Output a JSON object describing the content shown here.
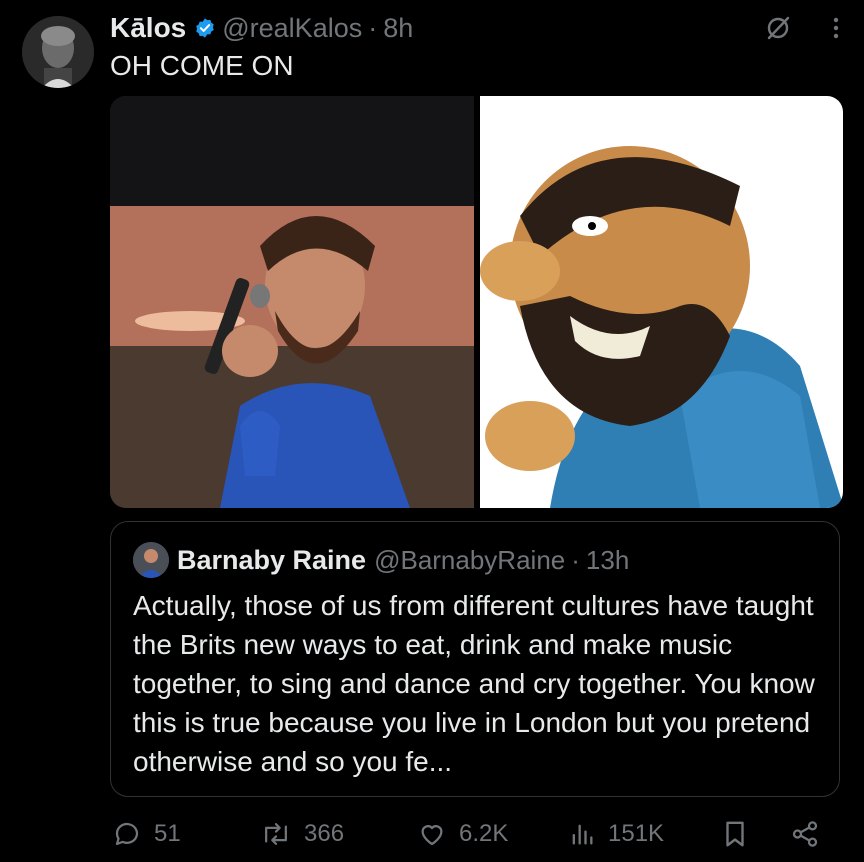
{
  "tweet": {
    "author_name": "Kālos",
    "author_handle": "@realKalos",
    "separator": "·",
    "time": "8h",
    "text": "OH COME ON"
  },
  "quote": {
    "author_name": "Barnaby Raine",
    "author_handle": "@BarnabyRaine",
    "separator": "·",
    "time": "13h",
    "text": "Actually, those of us from different cultures have taught the Brits new ways to eat, drink and make music together, to sing and dance and cry together. You know this is true because you live in London but you pretend otherwise and so you fe..."
  },
  "actions": {
    "replies": "51",
    "reposts": "366",
    "likes": "6.2K",
    "views": "151K"
  },
  "colors": {
    "background": "#000000",
    "text": "#e7e9ea",
    "muted": "#71767b",
    "border": "#2f3336",
    "verified": "#1d9bf0"
  },
  "icons": [
    "verified-badge-icon",
    "grok-icon",
    "more-icon",
    "reply-icon",
    "repost-icon",
    "like-icon",
    "views-icon",
    "bookmark-icon",
    "share-icon"
  ]
}
